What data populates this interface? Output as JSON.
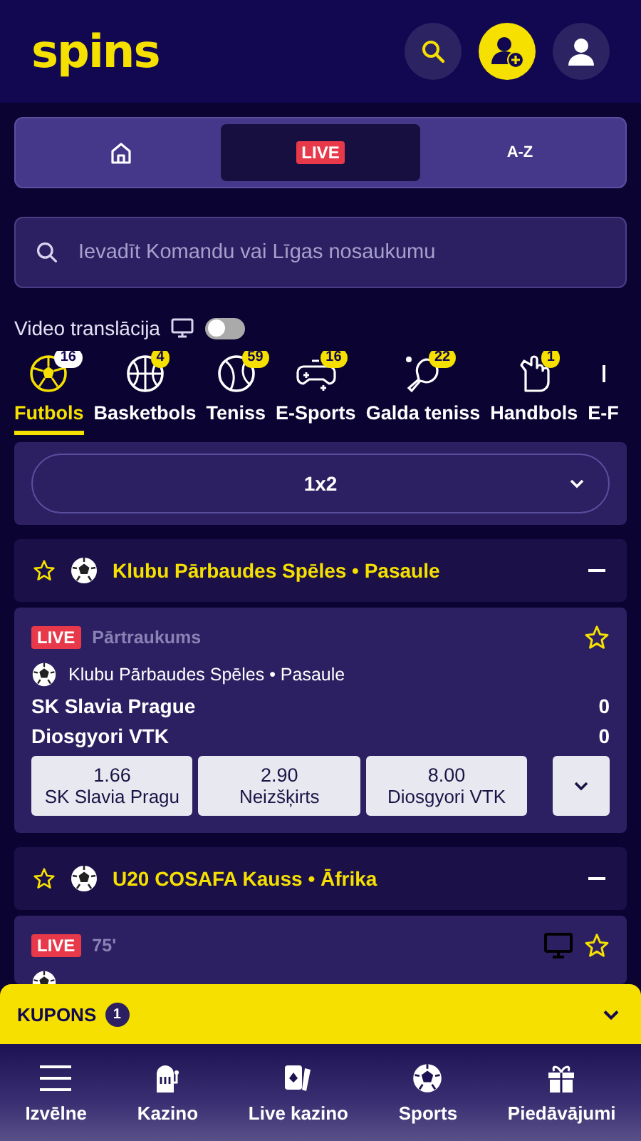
{
  "header": {
    "logo": "spins"
  },
  "nav_tabs": [
    {
      "kind": "home",
      "selected": false
    },
    {
      "kind": "live",
      "label": "LIVE",
      "selected": true
    },
    {
      "kind": "text",
      "label": "A-Z",
      "selected": false
    }
  ],
  "search": {
    "placeholder": "Ievadīt Komandu vai Līgas nosaukumu"
  },
  "video": {
    "label": "Video translācija",
    "on": false
  },
  "sports": [
    {
      "kind": "football",
      "label": "Futbols",
      "count": "16",
      "selected": true
    },
    {
      "kind": "basketball",
      "label": "Basketbols",
      "count": "4",
      "selected": false
    },
    {
      "kind": "tennis",
      "label": "Teniss",
      "count": "59",
      "selected": false
    },
    {
      "kind": "gamepad",
      "label": "E-Sports",
      "count": "16",
      "selected": false
    },
    {
      "kind": "pingpong",
      "label": "Galda teniss",
      "count": "22",
      "selected": false
    },
    {
      "kind": "hand",
      "label": "Handbols",
      "count": "1",
      "selected": false
    },
    {
      "kind": "partial",
      "label": "E-F",
      "selected": false
    }
  ],
  "market": {
    "label": "1x2"
  },
  "leagues": [
    {
      "title": "Klubu Pārbaudes Spēles • Pasaule",
      "expanded": true,
      "matches": [
        {
          "live": "LIVE",
          "status": "Pārtraukums",
          "tv": false,
          "league": "Klubu Pārbaudes Spēles • Pasaule",
          "teams": [
            {
              "name": "SK Slavia Prague",
              "score": "0"
            },
            {
              "name": "Diosgyori VTK",
              "score": "0"
            }
          ],
          "odds": [
            {
              "value": "1.66",
              "label": "SK Slavia Pragu"
            },
            {
              "value": "2.90",
              "label": "Neizšķirts"
            },
            {
              "value": "8.00",
              "label": "Diosgyori VTK"
            }
          ]
        }
      ]
    },
    {
      "title": "U20 COSAFA Kauss • Āfrika",
      "expanded": true,
      "matches": [
        {
          "live": "LIVE",
          "status": "75'",
          "tv": true
        }
      ]
    }
  ],
  "coupon": {
    "label": "KUPONS",
    "count": "1"
  },
  "bottom_nav": [
    {
      "kind": "menu",
      "label": "Izvēlne"
    },
    {
      "kind": "slot",
      "label": "Kazino"
    },
    {
      "kind": "cards",
      "label": "Live kazino"
    },
    {
      "kind": "ball",
      "label": "Sports"
    },
    {
      "kind": "gift",
      "label": "Piedāvājumi"
    }
  ]
}
